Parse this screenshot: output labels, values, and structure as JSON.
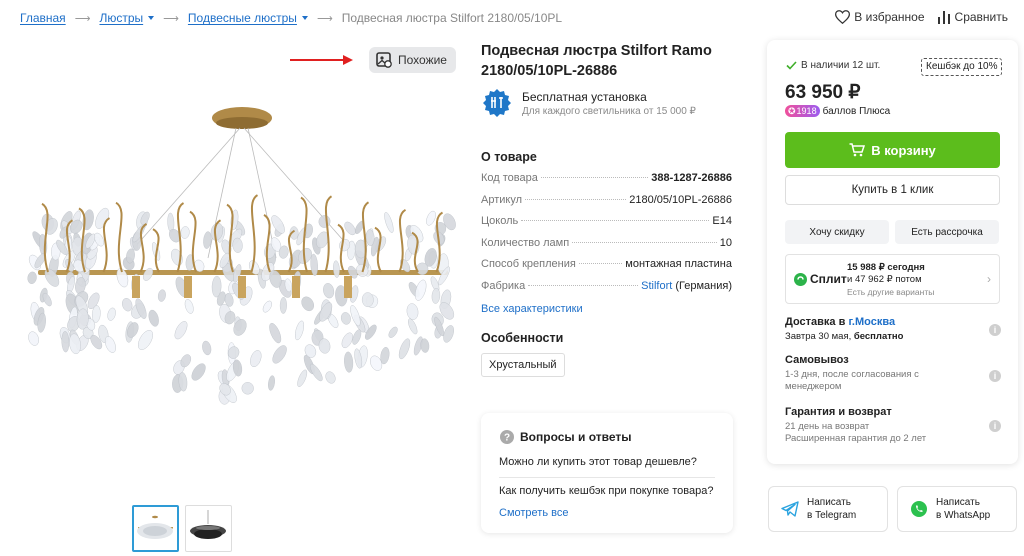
{
  "breadcrumb": {
    "items": [
      {
        "label": "Главная"
      },
      {
        "label": "Люстры"
      },
      {
        "label": "Подвесные люстры"
      }
    ],
    "current": "Подвесная люстра Stilfort 2180/05/10PL"
  },
  "top_actions": {
    "favorite": "В избранное",
    "compare": "Сравнить"
  },
  "gallery": {
    "similar_label": "Похожие",
    "thumbnail_count": 2,
    "active_thumbnail": 1
  },
  "product": {
    "title": "Подвесная люстра Stilfort Ramo 2180/05/10PL-26886",
    "install": {
      "title": "Бесплатная установка",
      "subtitle": "Для каждого светильника от 15 000 ₽"
    },
    "about_title": "О товаре",
    "specs": [
      {
        "label": "Код товара",
        "value": "388-1287-26886"
      },
      {
        "label": "Артикул",
        "value": "2180/05/10PL-26886"
      },
      {
        "label": "Цоколь",
        "value": "E14"
      },
      {
        "label": "Количество ламп",
        "value": "10"
      },
      {
        "label": "Способ крепления",
        "value": "монтажная пластина"
      },
      {
        "label": "Фабрика",
        "link": "Stilfort",
        "suffix": "(Германия)"
      }
    ],
    "all_specs": "Все характеристики",
    "features_title": "Особенности",
    "feature_chip": "Хрустальный"
  },
  "qa": {
    "title": "Вопросы и ответы",
    "questions": [
      "Можно ли купить этот товар дешевле?",
      "Как получить кешбэк при покупке товара?"
    ],
    "see_all": "Смотреть все"
  },
  "buy": {
    "stock": "В наличии 12 шт.",
    "cashback": "Кешбэк до 10%",
    "price": "63 950 ₽",
    "plus_points": "1918",
    "plus_text": "баллов Плюса",
    "cart_label": "В корзину",
    "oneclick_label": "Купить в 1 клик",
    "discount_label": "Хочу скидку",
    "installment_label": "Есть рассрочка",
    "split": {
      "brand": "Сплит",
      "line1": "15 988 ₽ сегодня",
      "line2": "и 47 962 ₽ потом",
      "line3": "Есть другие варианты"
    },
    "delivery": {
      "title_prefix": "Доставка в",
      "city": "г.Москва",
      "date": "Завтра 30 мая,",
      "free": "бесплатно"
    },
    "pickup": {
      "title": "Самовывоз",
      "desc": "1-3 дня, после согласования с менеджером"
    },
    "warranty": {
      "title": "Гарантия и возврат",
      "line1": "21 день на возврат",
      "line2": "Расширенная гарантия до 2 лет"
    }
  },
  "messengers": {
    "telegram": {
      "line1": "Написать",
      "line2": "в Telegram"
    },
    "whatsapp": {
      "line1": "Написать",
      "line2": "в WhatsApp"
    }
  },
  "colors": {
    "link": "#1e6fc8",
    "cart_green": "#5cbd1c",
    "arrow_red": "#e02020",
    "telegram": "#2aa3df",
    "whatsapp": "#2cc14f"
  }
}
